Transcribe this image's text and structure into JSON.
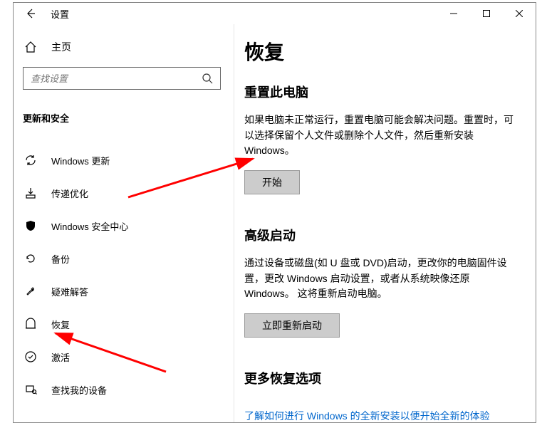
{
  "window": {
    "title": "设置"
  },
  "sidebar": {
    "home_label": "主页",
    "search_placeholder": "查找设置",
    "section_title": "更新和安全",
    "items": [
      {
        "label": "Windows 更新"
      },
      {
        "label": "传递优化"
      },
      {
        "label": "Windows 安全中心"
      },
      {
        "label": "备份"
      },
      {
        "label": "疑难解答"
      },
      {
        "label": "恢复"
      },
      {
        "label": "激活"
      },
      {
        "label": "查找我的设备"
      }
    ]
  },
  "main": {
    "page_title": "恢复",
    "reset": {
      "heading": "重置此电脑",
      "desc": "如果电脑未正常运行，重置电脑可能会解决问题。重置时，可以选择保留个人文件或删除个人文件，然后重新安装 Windows。",
      "button": "开始"
    },
    "advanced": {
      "heading": "高级启动",
      "desc": "通过设备或磁盘(如 U 盘或 DVD)启动，更改你的电脑固件设置，更改 Windows 启动设置，或者从系统映像还原 Windows。 这将重新启动电脑。",
      "button": "立即重新启动"
    },
    "more": {
      "heading": "更多恢复选项",
      "link": "了解如何进行 Windows 的全新安装以便开始全新的体验"
    }
  }
}
